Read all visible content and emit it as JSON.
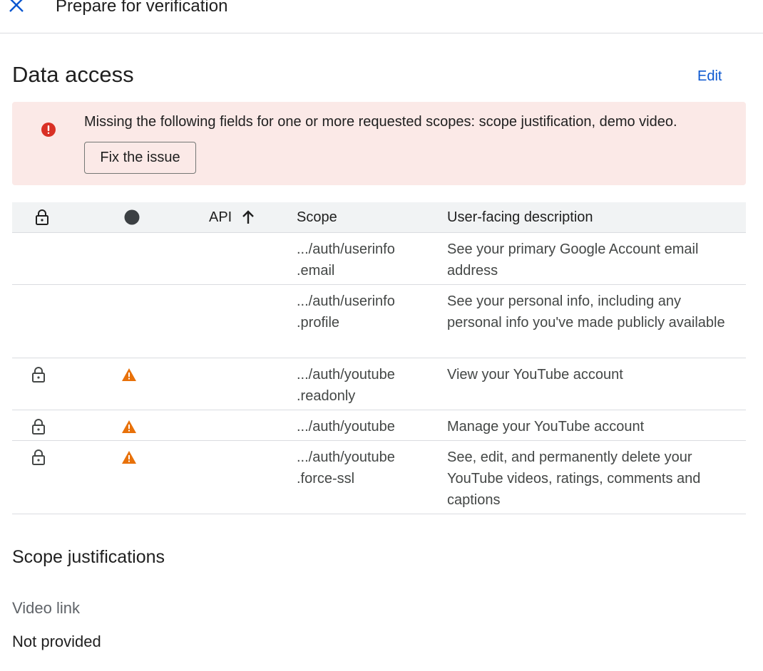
{
  "header": {
    "title": "Prepare for verification",
    "close_icon": "close-icon"
  },
  "data_access": {
    "title": "Data access",
    "edit_label": "Edit",
    "banner": {
      "icon": "error-icon",
      "color": "#d93025",
      "message": "Missing the following fields for one or more requested scopes: scope justification, demo video.",
      "button_label": "Fix the issue"
    },
    "table": {
      "columns": {
        "lock_icon": "lock-icon",
        "status_icon": "status-dot-icon",
        "api": "API",
        "sort_icon": "arrow-up-icon",
        "scope": "Scope",
        "description": "User-facing description"
      },
      "rows": [
        {
          "restricted": false,
          "warning": false,
          "scope_line1": ".../auth/userinfo",
          "scope_line2": ".email",
          "description": "See your primary Google Account email address"
        },
        {
          "restricted": false,
          "warning": false,
          "scope_line1": ".../auth/userinfo",
          "scope_line2": ".profile",
          "description": "See your personal info, including any personal info you've made publicly available"
        },
        {
          "restricted": true,
          "warning": true,
          "scope_line1": ".../auth/youtube",
          "scope_line2": ".readonly",
          "description": "View your YouTube account"
        },
        {
          "restricted": true,
          "warning": true,
          "scope_line1": ".../auth/youtube",
          "scope_line2": "",
          "description": "Manage your YouTube account"
        },
        {
          "restricted": true,
          "warning": true,
          "scope_line1": ".../auth/youtube",
          "scope_line2": ".force-ssl",
          "description": "See, edit, and permanently delete your YouTube videos, ratings, comments and captions"
        }
      ],
      "warning_color": "#e8710a"
    }
  },
  "scope_justifications": {
    "title": "Scope justifications",
    "video_link_label": "Video link",
    "video_link_value": "Not provided"
  }
}
